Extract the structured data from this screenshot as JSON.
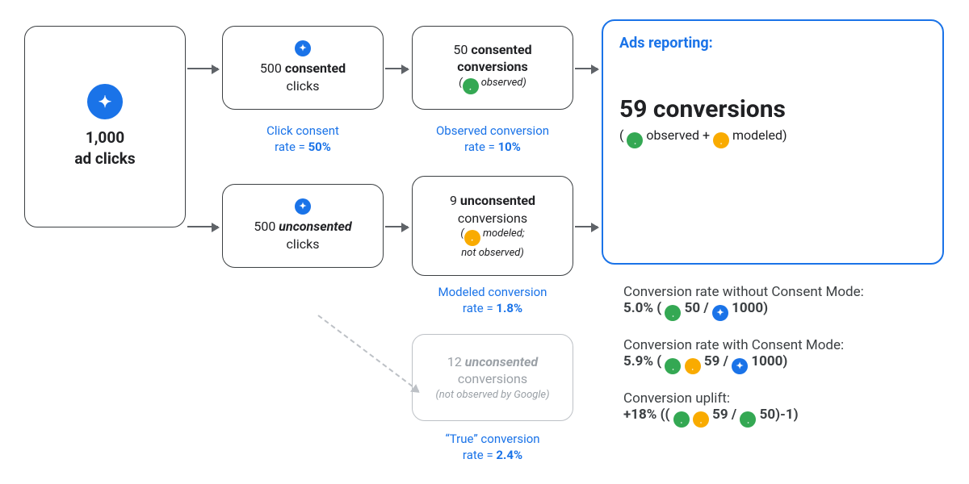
{
  "start": {
    "count": "1,000",
    "label": "ad clicks"
  },
  "consented_clicks": {
    "count": "500",
    "word": "consented",
    "label": "clicks"
  },
  "unconsented_clicks": {
    "count": "500",
    "word": "unconsented",
    "label": "clicks"
  },
  "consented_conv": {
    "count": "50",
    "word": "consented",
    "label": "conversions",
    "note": "observed)"
  },
  "unconsented_conv": {
    "count": "9",
    "word": "unconsented",
    "label": "conversions",
    "note": "modeled;",
    "note2": "not observed)"
  },
  "true_conv": {
    "count": "12",
    "word": "unconsented",
    "label": "conversions",
    "note": "(not observed by Google)"
  },
  "captions": {
    "click_consent_a": "Click consent",
    "click_consent_b": "rate = ",
    "click_consent_v": "50%",
    "observed_a": "Observed conversion",
    "observed_b": "rate = ",
    "observed_v": "10%",
    "modeled_a": "Modeled conversion",
    "modeled_b": "rate = ",
    "modeled_v": "1.8%",
    "true_a": "“True” conversion",
    "true_b": "rate = ",
    "true_v": "2.4%"
  },
  "report": {
    "title": "Ads reporting:",
    "headline": "59 conversions",
    "sub1": "observed + ",
    "sub2": "modeled)"
  },
  "stats": {
    "row1_label": "Conversion rate without Consent Mode:",
    "row1_pct": "5.0% (",
    "row1_a": "50 / ",
    "row1_b": "1000",
    "row1_end": ")",
    "row2_label": "Conversion rate with Consent Mode:",
    "row2_pct": "5.9% (",
    "row2_a": "59 / ",
    "row2_b": "1000",
    "row2_end": ")",
    "row3_label": "Conversion uplift:",
    "row3_pct": "+18% ((",
    "row3_a": "59 / ",
    "row3_b": "50)-1",
    "row3_end": ")"
  },
  "glyph": {
    "click": "✦",
    "swirl": "܂"
  }
}
